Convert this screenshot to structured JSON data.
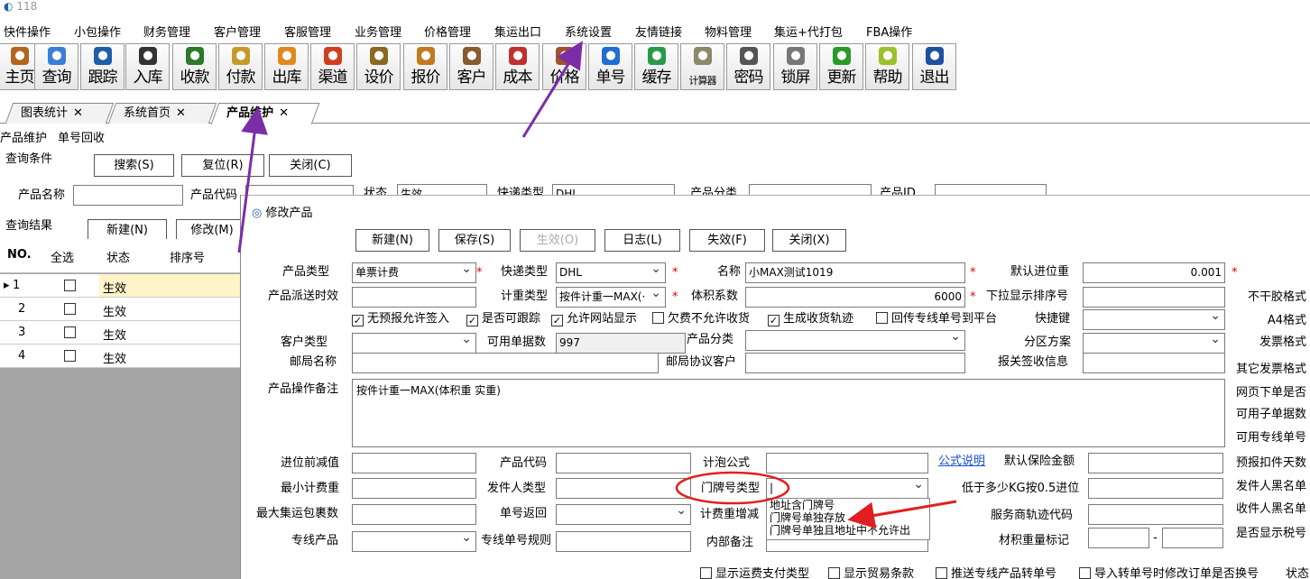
{
  "window": {
    "title": "118"
  },
  "menu": [
    "快件操作",
    "小包操作",
    "财务管理",
    "客户管理",
    "客服管理",
    "业务管理",
    "价格管理",
    "集运出口",
    "系统设置",
    "友情链接",
    "物料管理",
    "集运+代打包",
    "FBA操作"
  ],
  "toolbar": [
    {
      "label": "主页",
      "icon": "home-icon",
      "color": "#b5651d"
    },
    {
      "label": "查询",
      "icon": "magnifier-icon",
      "color": "#3a7fd5"
    },
    {
      "label": "跟踪",
      "icon": "wifi-icon",
      "color": "#1e5fa8"
    },
    {
      "label": "入库",
      "icon": "hammer-icon",
      "color": "#333333"
    },
    {
      "label": "收款",
      "icon": "yen-icon",
      "color": "#2a7a2a"
    },
    {
      "label": "付款",
      "icon": "handshake-icon",
      "color": "#c89a2a"
    },
    {
      "label": "出库",
      "icon": "envelope-icon",
      "color": "#e08a1e"
    },
    {
      "label": "渠道",
      "icon": "swirl-icon",
      "color": "#d04020"
    },
    {
      "label": "设价",
      "icon": "scale-icon",
      "color": "#8a6a20"
    },
    {
      "label": "报价",
      "icon": "document-icon",
      "color": "#c07a20"
    },
    {
      "label": "客户",
      "icon": "people-icon",
      "color": "#8a5a30"
    },
    {
      "label": "成本",
      "icon": "chart-icon",
      "color": "#c03030"
    },
    {
      "label": "价格",
      "icon": "price-icon",
      "color": "#a0522d"
    },
    {
      "label": "单号",
      "icon": "eye-icon",
      "color": "#1e6fd0"
    },
    {
      "label": "缓存",
      "icon": "refresh-icon",
      "color": "#2a9a4a"
    },
    {
      "label": "计算器",
      "icon": "calculator-icon",
      "color": "#8a8a6a"
    },
    {
      "label": "密码",
      "icon": "key-icon",
      "color": "#555555"
    },
    {
      "label": "锁屏",
      "icon": "lock-icon",
      "color": "#777777"
    },
    {
      "label": "更新",
      "icon": "download-arrow-icon",
      "color": "#2a9a2a"
    },
    {
      "label": "帮助",
      "icon": "help-icon",
      "color": "#9ac22a"
    },
    {
      "label": "退出",
      "icon": "power-icon",
      "color": "#1e4fa0"
    }
  ],
  "tabs": [
    {
      "label": "图表统计"
    },
    {
      "label": "系统首页"
    },
    {
      "label": "产品维护"
    }
  ],
  "subtabs": [
    "产品维护",
    "单号回收"
  ],
  "query": {
    "section_label": "查询条件",
    "buttons": [
      "搜索(S)",
      "复位(R)",
      "关闭(C)"
    ],
    "product_name_label": "产品名称",
    "product_code_label": "产品代码",
    "status_label": "状态",
    "status_value": "生效",
    "express_type_label": "快递类型",
    "express_type_value": "DHL",
    "category_label": "产品分类",
    "product_id_label": "产品ID"
  },
  "results": {
    "section_label": "查询结果",
    "buttons": [
      "新建(N)",
      "修改(M)"
    ],
    "columns": [
      "NO.",
      "全选",
      "状态",
      "排序号"
    ],
    "rows": [
      {
        "no": "1",
        "status": "生效",
        "selected": true
      },
      {
        "no": "2",
        "status": "生效",
        "selected": false
      },
      {
        "no": "3",
        "status": "生效",
        "selected": false
      },
      {
        "no": "4",
        "status": "生效",
        "selected": false
      }
    ]
  },
  "dialog": {
    "title": "修改产品",
    "buttons": [
      {
        "label": "新建(N)"
      },
      {
        "label": "保存(S)"
      },
      {
        "label": "生效(O)",
        "disabled": true
      },
      {
        "label": "日志(L)"
      },
      {
        "label": "失效(F)"
      },
      {
        "label": "关闭(X)"
      }
    ],
    "fields": {
      "product_type": {
        "label": "产品类型",
        "value": "单票计费"
      },
      "express_type": {
        "label": "快递类型",
        "value": "DHL"
      },
      "name": {
        "label": "名称",
        "value": "小MAX测试1019"
      },
      "default_rounding": {
        "label": "默认进位重",
        "value": "0.001"
      },
      "delivery_time": {
        "label": "产品派送时效",
        "value": ""
      },
      "weight_type": {
        "label": "计重类型",
        "value": "按件计重一MAX(·"
      },
      "volume_factor": {
        "label": "体积系数",
        "value": "6000"
      },
      "dropdown_sort": {
        "label": "下拉显示排序号",
        "value": ""
      },
      "customer_type": {
        "label": "客户类型",
        "value": ""
      },
      "available_count": {
        "label": "可用单据数",
        "value": "997"
      },
      "product_category": {
        "label": "产品分类",
        "value": ""
      },
      "zone_plan": {
        "label": "分区方案",
        "value": ""
      },
      "hotkey": {
        "label": "快捷键",
        "value": ""
      },
      "post_name": {
        "label": "邮局名称",
        "value": ""
      },
      "post_customer": {
        "label": "邮局协议客户",
        "value": ""
      },
      "customs_info": {
        "label": "报关签收信息",
        "value": ""
      },
      "remark": {
        "label": "产品操作备注",
        "value": "按件计重一MAX(体积重 实重)"
      },
      "pre_rounding": {
        "label": "进位前减值",
        "value": ""
      },
      "product_code": {
        "label": "产品代码",
        "value": ""
      },
      "formula": {
        "label": "计泡公式",
        "value": ""
      },
      "formula_link": "公式说明",
      "default_insurance": {
        "label": "默认保险金额",
        "value": ""
      },
      "min_weight": {
        "label": "最小计费重",
        "value": ""
      },
      "sender_type": {
        "label": "发件人类型",
        "value": ""
      },
      "house_number_type": {
        "label": "门牌号类型",
        "value": "|"
      },
      "below_kg": {
        "label": "低于多少KG按0.5进位",
        "value": ""
      },
      "max_packages": {
        "label": "最大集运包裹数",
        "value": ""
      },
      "tracking_return": {
        "label": "单号返回",
        "value": ""
      },
      "weight_increase": {
        "label": "计费重增减",
        "value": ""
      },
      "service_track_code": {
        "label": "服务商轨迹代码",
        "value": ""
      },
      "line_product": {
        "label": "专线产品",
        "value": ""
      },
      "line_rule": {
        "label": "专线单号规则",
        "value": ""
      },
      "internal_note": {
        "label": "内部备注",
        "value": ""
      },
      "material_mark": {
        "label": "材积重量标记",
        "value": "",
        "sep": "-"
      }
    },
    "checkboxes": [
      {
        "label": "无预报允许签入",
        "checked": true
      },
      {
        "label": "是否可跟踪",
        "checked": true
      },
      {
        "label": "允许网站显示",
        "checked": true
      },
      {
        "label": "欠费不允许收货",
        "checked": false
      },
      {
        "label": "生成收货轨迹",
        "checked": true
      },
      {
        "label": "回传专线单号到平台",
        "checked": false
      }
    ],
    "bottom_checkboxes": [
      {
        "label": "显示运费支付类型",
        "checked": false
      },
      {
        "label": "显示贸易条款",
        "checked": false
      },
      {
        "label": "推送专线产品转单号",
        "checked": false
      },
      {
        "label": "导入转单号时修改订单是否换号",
        "checked": false
      }
    ],
    "bottom_right_label": "状态",
    "house_number_options": [
      "地址含门牌号",
      "门牌号单独存放",
      "门牌号单独且地址中不允许出"
    ],
    "right_labels": [
      "不干胶格式",
      "A4格式",
      "发票格式",
      "其它发票格式",
      "网页下单是否",
      "可用子单据数",
      "可用专线单号",
      "预报扣件天数",
      "发件人黑名单",
      "收件人黑名单",
      "是否显示税号"
    ]
  }
}
